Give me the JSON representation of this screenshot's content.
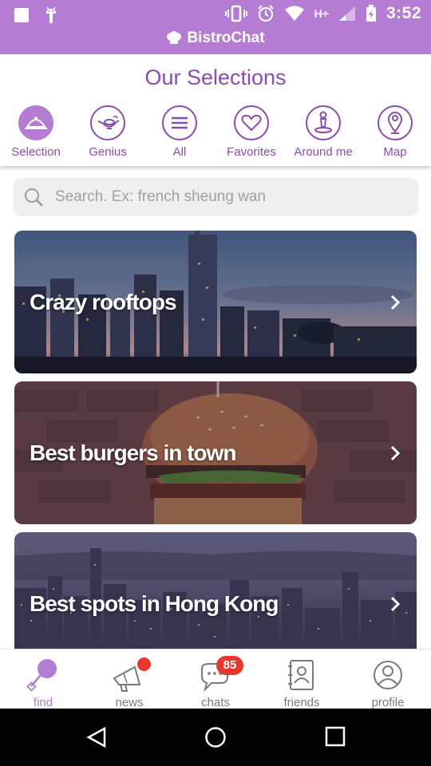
{
  "status_bar": {
    "time": "3:52",
    "app_name": "BistroChat",
    "network_label": "H+"
  },
  "header": {
    "title": "Our Selections",
    "categories": [
      {
        "label": "Selection",
        "icon": "cloche-icon",
        "active": true
      },
      {
        "label": "Genius",
        "icon": "genie-lamp-icon",
        "active": false
      },
      {
        "label": "All",
        "icon": "list-icon",
        "active": false
      },
      {
        "label": "Favorites",
        "icon": "heart-icon",
        "active": false
      },
      {
        "label": "Around me",
        "icon": "person-pin-icon",
        "active": false
      },
      {
        "label": "Map",
        "icon": "map-pin-icon",
        "active": false
      }
    ]
  },
  "search": {
    "placeholder": "Search. Ex: french sheung wan"
  },
  "cards": [
    {
      "title": "Crazy rooftops"
    },
    {
      "title": "Best burgers in town"
    },
    {
      "title": "Best spots in Hong Kong"
    }
  ],
  "tabs": [
    {
      "label": "find",
      "icon": "search-bubble-icon",
      "active": true
    },
    {
      "label": "news",
      "icon": "megaphone-icon",
      "active": false
    },
    {
      "label": "chats",
      "icon": "chat-bubble-icon",
      "active": false,
      "badge": "85"
    },
    {
      "label": "friends",
      "icon": "contacts-book-icon",
      "active": false
    },
    {
      "label": "profile",
      "icon": "user-icon",
      "active": false
    }
  ],
  "colors": {
    "accent": "#b57cd3",
    "accent_dark": "#8a4cb0",
    "badge": "#e8372d"
  }
}
